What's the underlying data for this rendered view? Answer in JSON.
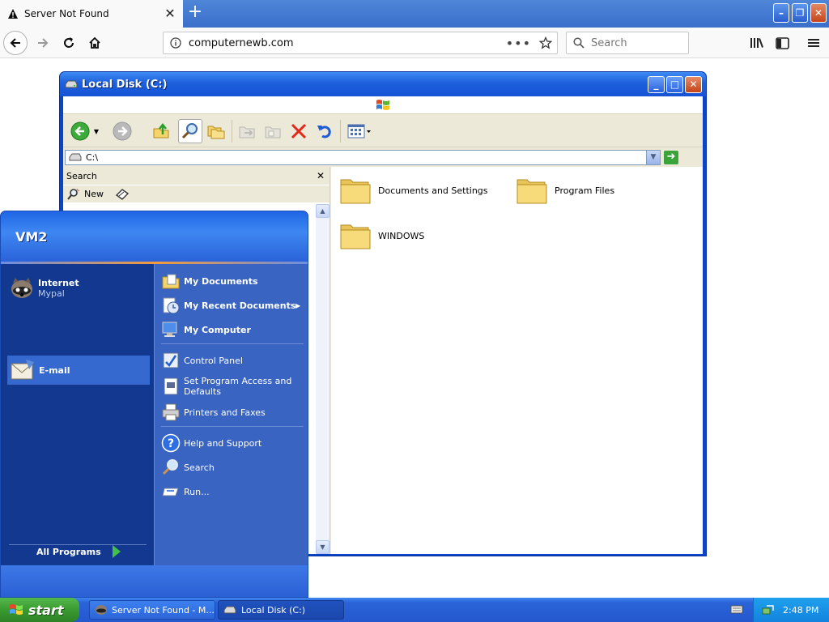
{
  "browser": {
    "tab_title": "Server Not Found",
    "url": "computernewb.com",
    "search_placeholder": "Search"
  },
  "explorer": {
    "title": "Local Disk (C:)",
    "address": "C:\\",
    "search_pane_title": "Search",
    "search_new_label": "New",
    "files": [
      {
        "name": "Documents and Settings"
      },
      {
        "name": "Program Files"
      },
      {
        "name": "WINDOWS"
      }
    ]
  },
  "start_menu": {
    "user": "VM2",
    "pinned": [
      {
        "label": "Internet",
        "sub": "Mypal"
      },
      {
        "label": "E-mail"
      }
    ],
    "all_programs": "All Programs",
    "right_items": [
      {
        "label": "My Documents"
      },
      {
        "label": "My Recent Documents"
      },
      {
        "label": "My Computer"
      },
      {
        "label": "Control Panel"
      },
      {
        "label": "Set Program Access and Defaults"
      },
      {
        "label": "Printers and Faxes"
      },
      {
        "label": "Help and Support"
      },
      {
        "label": "Search"
      },
      {
        "label": "Run..."
      }
    ]
  },
  "taskbar": {
    "start_label": "start",
    "tasks": [
      {
        "label": "Server Not Found - M..."
      },
      {
        "label": "Local Disk (C:)"
      }
    ],
    "clock": "2:48 PM"
  },
  "colors": {
    "xp_blue": "#1653d6",
    "start_green": "#3a9a30",
    "folder_yellow": "#f5d56b"
  }
}
